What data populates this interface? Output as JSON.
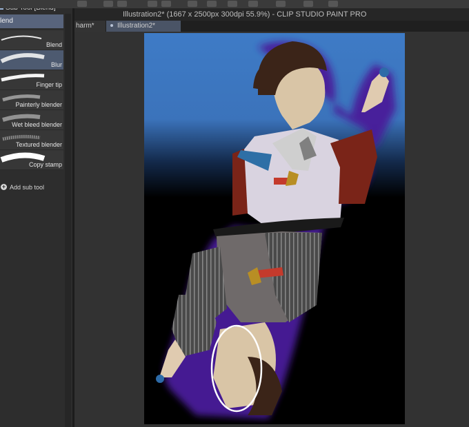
{
  "window": {
    "title": "Illustration2* (1667 x 2500px 300dpi 55.9%)  - CLIP STUDIO PAINT PRO",
    "tabs": [
      {
        "label": "harm*"
      },
      {
        "label": "Illustration2*"
      }
    ]
  },
  "sidebar": {
    "header": "Sub Tool [Blend]",
    "selected_group": "lend",
    "items": [
      {
        "label": "Blend"
      },
      {
        "label": "Blur"
      },
      {
        "label": "Finger tip"
      },
      {
        "label": "Painterly blender"
      },
      {
        "label": "Wet bleed blender"
      },
      {
        "label": "Textured blender"
      },
      {
        "label": "Copy stamp"
      }
    ],
    "add_label": "Add sub tool"
  },
  "colors": {
    "canvas_blue": "#3f7cc4",
    "glow_purple": "#5a1fa8",
    "panel_bg": "#2d2d2d",
    "selected_bg": "#4d5a70"
  }
}
